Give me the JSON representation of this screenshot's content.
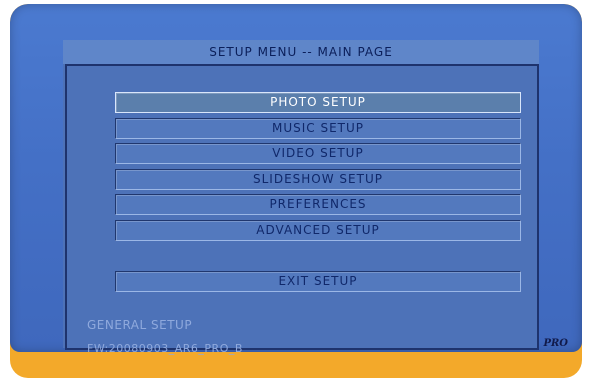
{
  "header": {
    "title": "SETUP MENU -- MAIN PAGE"
  },
  "menu": {
    "selected_index": 0,
    "items": [
      {
        "label": "PHOTO SETUP"
      },
      {
        "label": "MUSIC SETUP"
      },
      {
        "label": "VIDEO SETUP"
      },
      {
        "label": "SLIDESHOW SETUP"
      },
      {
        "label": "PREFERENCES"
      },
      {
        "label": "ADVANCED SETUP"
      }
    ],
    "exit_label": "EXIT SETUP"
  },
  "footer": {
    "section_label": "GENERAL SETUP",
    "firmware_label": "FW:20080903_AR6_PRO_B",
    "badge": "PRO"
  },
  "colors": {
    "screen_blue": "#4470c6",
    "bezel_orange": "#f3a92a",
    "selected_text": "#ffffff",
    "text_dark": "#10286a"
  }
}
